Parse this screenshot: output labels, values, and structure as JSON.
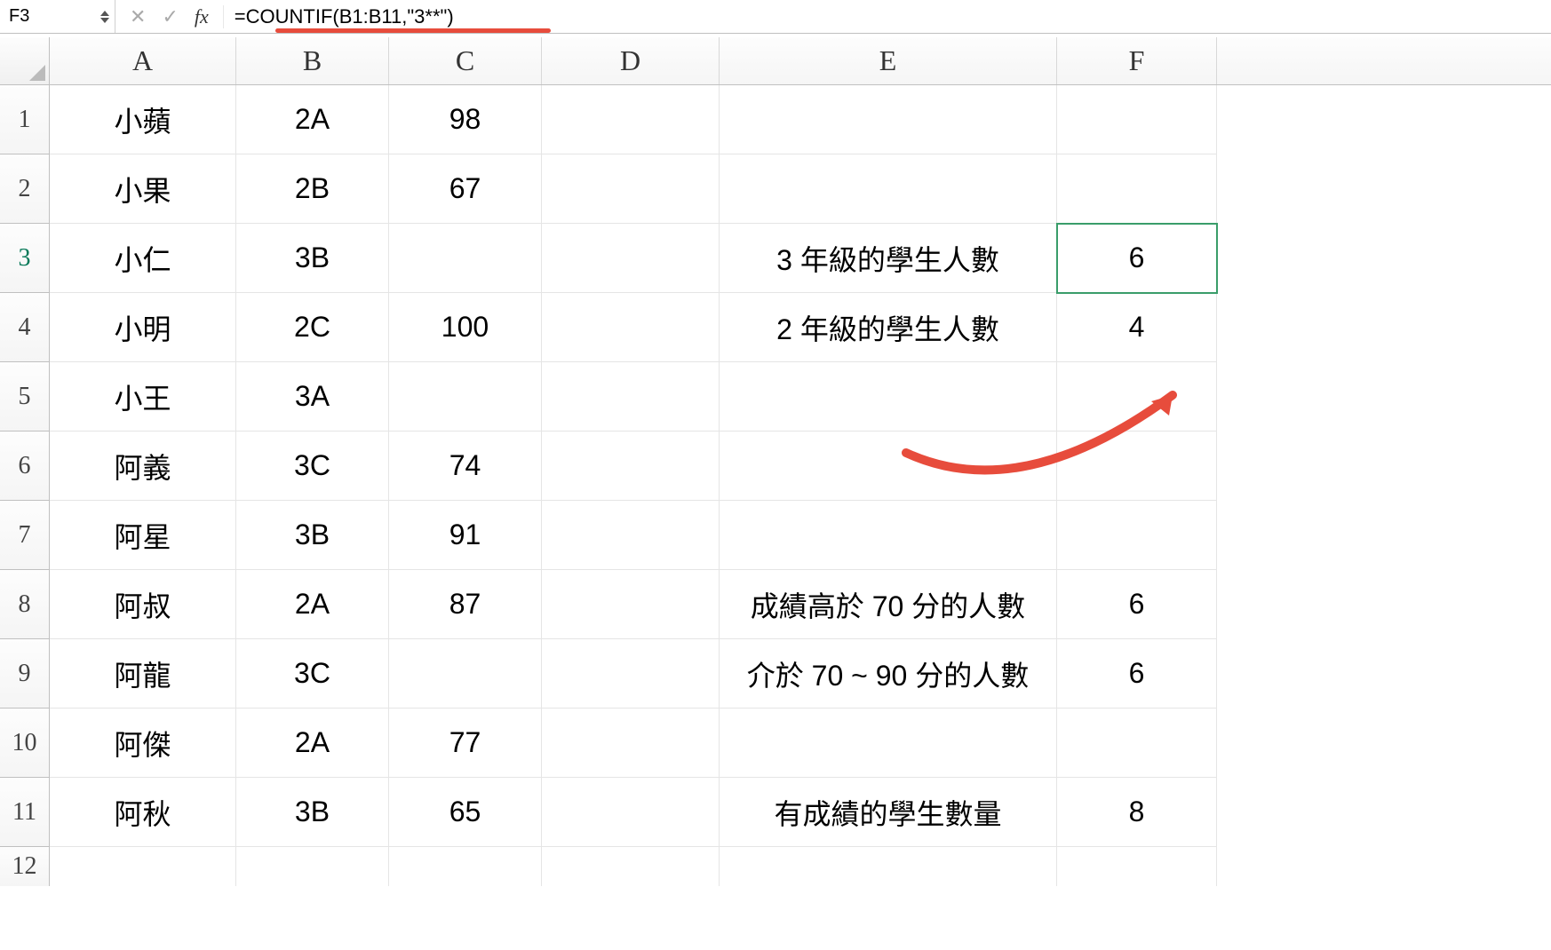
{
  "namebox": "F3",
  "fx_label": "fx",
  "formula": "=COUNTIF(B1:B11,\"3**\")",
  "columns": [
    "A",
    "B",
    "C",
    "D",
    "E",
    "F"
  ],
  "row_headers": [
    "1",
    "2",
    "3",
    "4",
    "5",
    "6",
    "7",
    "8",
    "9",
    "10",
    "11",
    "12"
  ],
  "grid": {
    "A": [
      "小蘋",
      "小果",
      "小仁",
      "小明",
      "小王",
      "阿義",
      "阿星",
      "阿叔",
      "阿龍",
      "阿傑",
      "阿秋",
      ""
    ],
    "B": [
      "2A",
      "2B",
      "3B",
      "2C",
      "3A",
      "3C",
      "3B",
      "2A",
      "3C",
      "2A",
      "3B",
      ""
    ],
    "C": [
      "98",
      "67",
      "",
      "100",
      "",
      "74",
      "91",
      "87",
      "",
      "77",
      "65",
      ""
    ],
    "D": [
      "",
      "",
      "",
      "",
      "",
      "",
      "",
      "",
      "",
      "",
      "",
      ""
    ],
    "E": [
      "",
      "",
      "3 年級的學生人數",
      "2 年級的學生人數",
      "",
      "",
      "",
      "成績高於 70 分的人數",
      "介於 70 ~ 90 分的人數",
      "",
      "有成績的學生數量",
      ""
    ],
    "F": [
      "",
      "",
      "6",
      "4",
      "",
      "",
      "",
      "6",
      "6",
      "",
      "8",
      ""
    ]
  },
  "selected_cell": "F3"
}
